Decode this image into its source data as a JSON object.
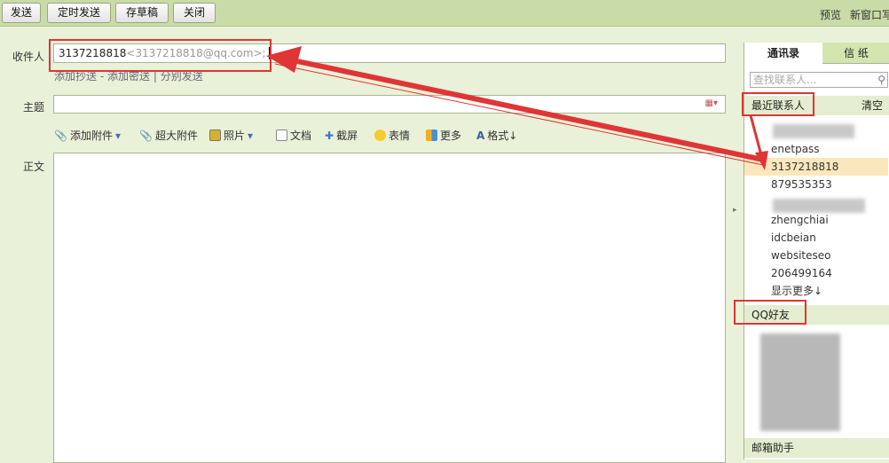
{
  "toolbar": {
    "send": "发送",
    "scheduled_send": "定时发送",
    "save_draft": "存草稿",
    "close": "关闭",
    "preview": "预览",
    "new_window": "新窗口写"
  },
  "compose": {
    "to_label": "收件人",
    "to_name": "3137218818",
    "to_email": "<3137218818@qq.com>;",
    "add_cc": "添加抄送",
    "sep1": "-",
    "add_bcc": "添加密送",
    "sep2": "|",
    "separate_send": "分别发送",
    "subject_label": "主题",
    "subject_value": "",
    "body_label": "正文",
    "tools": [
      {
        "label": "添加附件",
        "icon": "paperclip-icon"
      },
      {
        "label": "超大附件",
        "icon": "large-attachment-icon"
      },
      {
        "label": "照片",
        "icon": "photo-icon"
      },
      {
        "label": "文档",
        "icon": "document-icon"
      },
      {
        "label": "截屏",
        "icon": "screenshot-icon"
      },
      {
        "label": "表情",
        "icon": "emoji-icon"
      },
      {
        "label": "更多",
        "icon": "more-icon"
      },
      {
        "label": "格式↓",
        "icon": "format-icon"
      }
    ]
  },
  "sidebar": {
    "tabs": [
      "通讯录",
      "信 纸"
    ],
    "search_placeholder": "查找联系人...",
    "recent_title": "最近联系人",
    "clear": "清空",
    "recent": [
      "enetpass",
      "3137218818",
      "879535353",
      "zhengchiai",
      "idcbeian",
      "websiteseo",
      "206499164"
    ],
    "show_more": "显示更多↓",
    "qq_friends": "QQ好友",
    "mail_assistant": "邮箱助手"
  },
  "colors": {
    "highlight": "#fbe7bd",
    "annotation": "#e03535"
  }
}
